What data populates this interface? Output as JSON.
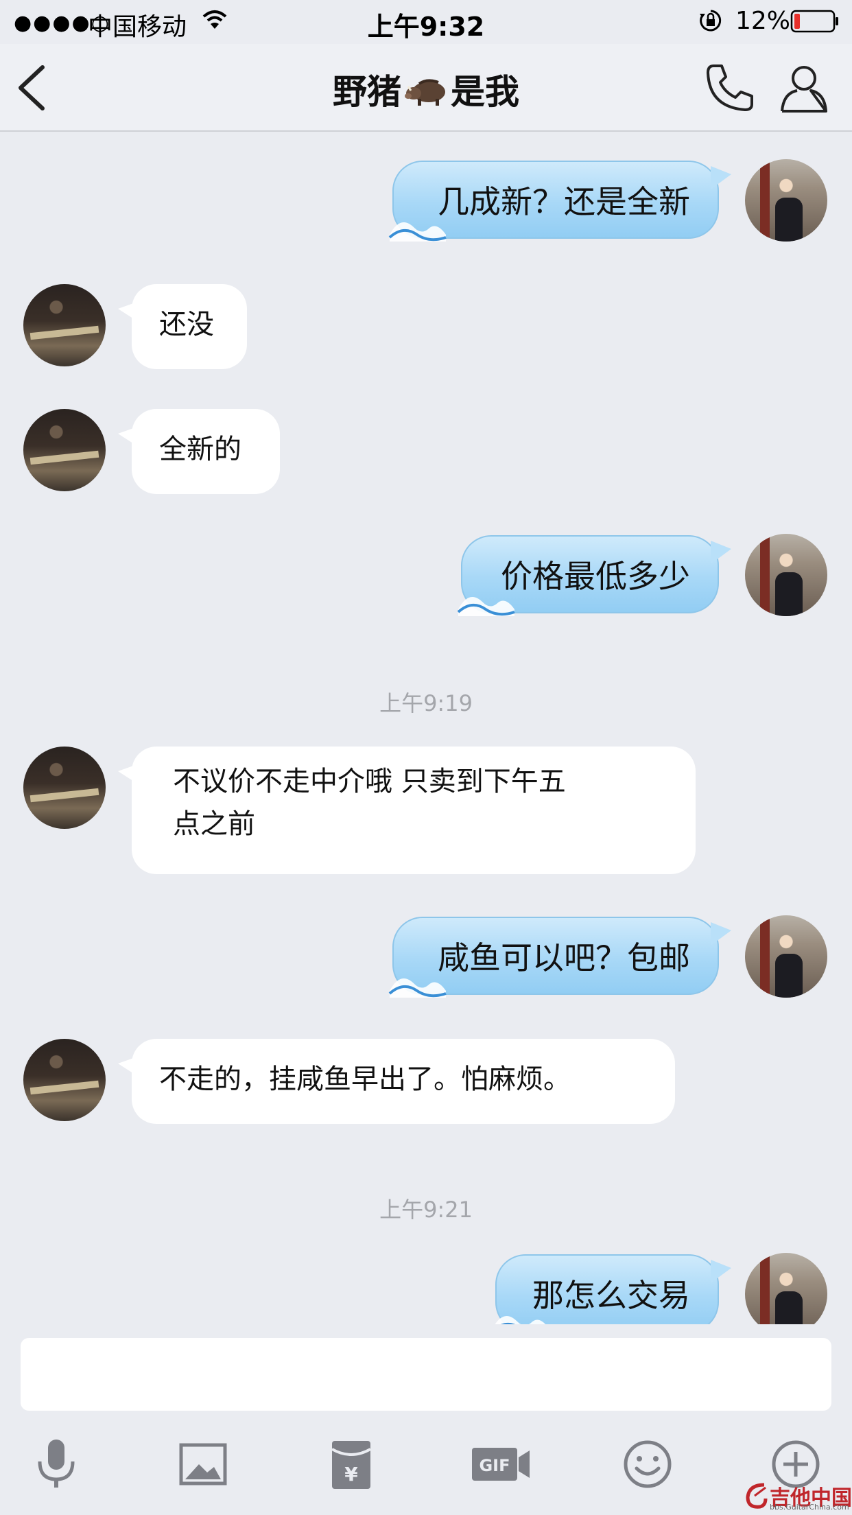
{
  "status_bar": {
    "signal": "●●●●○",
    "carrier": "中国移动",
    "time": "上午9:32",
    "battery": "12%"
  },
  "nav": {
    "title_left": "野猪",
    "title_right": "是我",
    "title_emoji": "boar-icon"
  },
  "messages": [
    {
      "side": "mine",
      "text": "几成新？还是全新"
    },
    {
      "side": "theirs",
      "text": "还没"
    },
    {
      "side": "theirs",
      "text": "全新的"
    },
    {
      "side": "mine",
      "text": "价格最低多少"
    },
    {
      "side": "theirs",
      "line1": "不议价不走中介哦  只卖到下午五",
      "line2": "点之前"
    },
    {
      "side": "mine",
      "text": "咸鱼可以吧？包邮"
    },
    {
      "side": "theirs",
      "text": "不走的，挂咸鱼早出了。怕麻烦。"
    },
    {
      "side": "mine",
      "text": "那怎么交易"
    }
  ],
  "timestamps": [
    "上午9:19",
    "上午9:21"
  ],
  "input": {
    "value": "",
    "placeholder": ""
  },
  "toolbar": [
    "microphone-icon",
    "image-icon",
    "red-packet-icon",
    "gif-icon",
    "emoji-icon",
    "plus-icon"
  ],
  "watermark": {
    "text": "吉他中国",
    "sub": "bbs.GuitarChina.com"
  },
  "colors": {
    "my_bubble": "#a8d8f7",
    "their_bubble": "#ffffff",
    "background": "#eaecf1"
  }
}
